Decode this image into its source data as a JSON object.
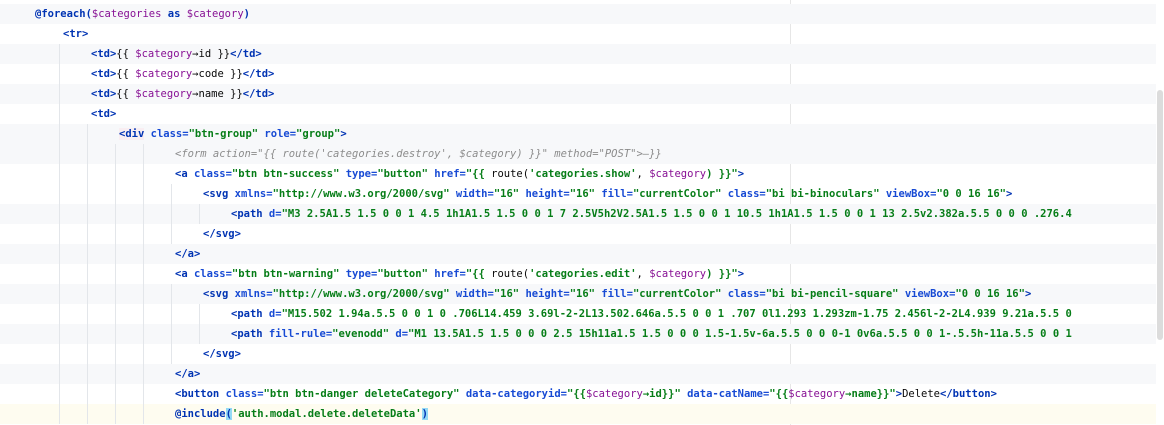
{
  "lines": [
    {
      "id": "foreach",
      "segments": [
        {
          "t": "@foreach(",
          "c": "kw"
        },
        {
          "t": "$categories",
          "c": "var"
        },
        {
          "t": " as ",
          "c": "kw"
        },
        {
          "t": "$category",
          "c": "var"
        },
        {
          "t": ")",
          "c": "kw"
        }
      ]
    },
    {
      "id": "tr-open",
      "segments": [
        {
          "t": "<tr>",
          "c": "tag"
        }
      ]
    },
    {
      "id": "td-id",
      "segments": [
        {
          "t": "<td>",
          "c": "tag"
        },
        {
          "t": "{{ ",
          "c": "plain"
        },
        {
          "t": "$category",
          "c": "var"
        },
        {
          "t": "→",
          "c": "plain"
        },
        {
          "t": "id",
          "c": "plain"
        },
        {
          "t": " }}",
          "c": "plain"
        },
        {
          "t": "</td>",
          "c": "tag"
        }
      ]
    },
    {
      "id": "td-code",
      "segments": [
        {
          "t": "<td>",
          "c": "tag"
        },
        {
          "t": "{{ ",
          "c": "plain"
        },
        {
          "t": "$category",
          "c": "var"
        },
        {
          "t": "→",
          "c": "plain"
        },
        {
          "t": "code",
          "c": "plain"
        },
        {
          "t": " }}",
          "c": "plain"
        },
        {
          "t": "</td>",
          "c": "tag"
        }
      ]
    },
    {
      "id": "td-name",
      "segments": [
        {
          "t": "<td>",
          "c": "tag"
        },
        {
          "t": "{{ ",
          "c": "plain"
        },
        {
          "t": "$category",
          "c": "var"
        },
        {
          "t": "→",
          "c": "plain"
        },
        {
          "t": "name",
          "c": "plain"
        },
        {
          "t": " }}",
          "c": "plain"
        },
        {
          "t": "</td>",
          "c": "tag"
        }
      ]
    },
    {
      "id": "td-open",
      "segments": [
        {
          "t": "<td>",
          "c": "tag"
        }
      ]
    },
    {
      "id": "div-open",
      "segments": [
        {
          "t": "<div",
          "c": "tag div-bg"
        },
        {
          "t": " class=",
          "c": "attr"
        },
        {
          "t": "\"btn-group\"",
          "c": "str"
        },
        {
          "t": " role=",
          "c": "attr"
        },
        {
          "t": "\"group\"",
          "c": "str"
        },
        {
          "t": ">",
          "c": "tag"
        }
      ]
    },
    {
      "id": "form-folded",
      "segments": [
        {
          "t": "<form action=\"{{ route('categories.destroy', $category) }}\" method=\"POST\">—}}",
          "c": "comment"
        }
      ]
    },
    {
      "id": "a-success",
      "segments": [
        {
          "t": "<a",
          "c": "tag"
        },
        {
          "t": " class=",
          "c": "attr"
        },
        {
          "t": "\"btn btn-success\"",
          "c": "str"
        },
        {
          "t": " type=",
          "c": "attr"
        },
        {
          "t": "\"button\"",
          "c": "str"
        },
        {
          "t": " href=",
          "c": "attr"
        },
        {
          "t": "\"{{ ",
          "c": "str"
        },
        {
          "t": "route(",
          "c": "plain"
        },
        {
          "t": "'categories.show'",
          "c": "str"
        },
        {
          "t": ", ",
          "c": "plain"
        },
        {
          "t": "$category",
          "c": "var"
        },
        {
          "t": ") }}\"",
          "c": "str"
        },
        {
          "t": ">",
          "c": "tag"
        }
      ]
    },
    {
      "id": "svg-binoculars",
      "segments": [
        {
          "t": "<svg",
          "c": "tag"
        },
        {
          "t": " xmlns=",
          "c": "attr"
        },
        {
          "t": "\"http://www.w3.org/2000/svg\"",
          "c": "str"
        },
        {
          "t": " width=",
          "c": "attr"
        },
        {
          "t": "\"16\"",
          "c": "str"
        },
        {
          "t": " height=",
          "c": "attr"
        },
        {
          "t": "\"16\"",
          "c": "str"
        },
        {
          "t": " fill=",
          "c": "attr"
        },
        {
          "t": "\"currentColor\"",
          "c": "str"
        },
        {
          "t": " class=",
          "c": "attr"
        },
        {
          "t": "\"bi bi-binoculars\"",
          "c": "str"
        },
        {
          "t": " viewBox=",
          "c": "attr"
        },
        {
          "t": "\"0 0 16 16\"",
          "c": "str"
        },
        {
          "t": ">",
          "c": "tag"
        }
      ]
    },
    {
      "id": "path-binoculars",
      "segments": [
        {
          "t": "<path",
          "c": "tag"
        },
        {
          "t": " d=",
          "c": "attr"
        },
        {
          "t": "\"M3 2.5A1.5 1.5 0 0 1 4.5 1h1A1.5 1.5 0 0 1 7 2.5V5h2V2.5A1.5 1.5 0 0 1 10.5 1h1A1.5 1.5 0 0 1 13 2.5v2.382a.5.5 0 0 0 .276.4",
          "c": "str"
        }
      ]
    },
    {
      "id": "svg-close-1",
      "segments": [
        {
          "t": "</svg>",
          "c": "tag"
        }
      ]
    },
    {
      "id": "a-close-1",
      "segments": [
        {
          "t": "</a>",
          "c": "tag"
        }
      ]
    },
    {
      "id": "a-warning",
      "segments": [
        {
          "t": "<a",
          "c": "tag"
        },
        {
          "t": " class=",
          "c": "attr"
        },
        {
          "t": "\"btn btn-warning\"",
          "c": "str"
        },
        {
          "t": " type=",
          "c": "attr"
        },
        {
          "t": "\"button\"",
          "c": "str"
        },
        {
          "t": " href=",
          "c": "attr"
        },
        {
          "t": "\"{{ ",
          "c": "str"
        },
        {
          "t": "route(",
          "c": "plain"
        },
        {
          "t": "'categories.edit'",
          "c": "str"
        },
        {
          "t": ", ",
          "c": "plain"
        },
        {
          "t": "$category",
          "c": "var"
        },
        {
          "t": ") }}\"",
          "c": "str"
        },
        {
          "t": ">",
          "c": "tag"
        }
      ]
    },
    {
      "id": "svg-pencil",
      "segments": [
        {
          "t": "<svg",
          "c": "tag"
        },
        {
          "t": " xmlns=",
          "c": "attr"
        },
        {
          "t": "\"http://www.w3.org/2000/svg\"",
          "c": "str"
        },
        {
          "t": " width=",
          "c": "attr"
        },
        {
          "t": "\"16\"",
          "c": "str"
        },
        {
          "t": " height=",
          "c": "attr"
        },
        {
          "t": "\"16\"",
          "c": "str"
        },
        {
          "t": " fill=",
          "c": "attr"
        },
        {
          "t": "\"currentColor\"",
          "c": "str"
        },
        {
          "t": " class=",
          "c": "attr"
        },
        {
          "t": "\"bi bi-pencil-square\"",
          "c": "str"
        },
        {
          "t": " viewBox=",
          "c": "attr"
        },
        {
          "t": "\"0 0 16 16\"",
          "c": "str"
        },
        {
          "t": ">",
          "c": "tag"
        }
      ]
    },
    {
      "id": "path-pencil-1",
      "segments": [
        {
          "t": "<path",
          "c": "tag"
        },
        {
          "t": " d=",
          "c": "attr"
        },
        {
          "t": "\"M15.502 1.94a.5.5 0 0 1 0 .706L14.459 3.69l-2-2L13.502.646a.5.5 0 0 1 .707 0l1.293 1.293zm-1.75 2.456l-2-2L4.939 9.21a.5.5 0",
          "c": "str"
        }
      ]
    },
    {
      "id": "path-pencil-2",
      "segments": [
        {
          "t": "<path",
          "c": "tag"
        },
        {
          "t": " fill-rule=",
          "c": "attr"
        },
        {
          "t": "\"evenodd\"",
          "c": "str"
        },
        {
          "t": " d=",
          "c": "attr"
        },
        {
          "t": "\"M1 13.5A1.5 1.5 0 0 0 2.5 15h11a1.5 1.5 0 0 0 1.5-1.5v-6a.5.5 0 0 0-1 0v6a.5.5 0 0 1-.5.5h-11a.5.5 0 0 1",
          "c": "str"
        }
      ]
    },
    {
      "id": "svg-close-2",
      "segments": [
        {
          "t": "</svg>",
          "c": "tag"
        }
      ]
    },
    {
      "id": "a-close-2",
      "segments": [
        {
          "t": "</a>",
          "c": "tag"
        }
      ]
    },
    {
      "id": "button-delete",
      "segments": [
        {
          "t": "<button",
          "c": "tag"
        },
        {
          "t": " class=",
          "c": "attr"
        },
        {
          "t": "\"btn btn-danger deleteCategory\"",
          "c": "str"
        },
        {
          "t": " data-categoryid=",
          "c": "attr"
        },
        {
          "t": "\"{{",
          "c": "str"
        },
        {
          "t": "$category",
          "c": "var"
        },
        {
          "t": "→id}}\"",
          "c": "str"
        },
        {
          "t": " data-catName=",
          "c": "attr"
        },
        {
          "t": "\"{{",
          "c": "str"
        },
        {
          "t": "$category",
          "c": "var"
        },
        {
          "t": "→name}}\"",
          "c": "str"
        },
        {
          "t": ">",
          "c": "tag"
        },
        {
          "t": "Delete",
          "c": "plain"
        },
        {
          "t": "</button>",
          "c": "tag"
        }
      ]
    },
    {
      "id": "include",
      "segments": [
        {
          "t": "@include",
          "c": "kw"
        },
        {
          "t": "(",
          "c": "kw caret-bracket"
        },
        {
          "t": "'auth.modal.delete.deleteData'",
          "c": "str"
        },
        {
          "t": ")",
          "c": "kw caret-bracket"
        }
      ]
    }
  ]
}
